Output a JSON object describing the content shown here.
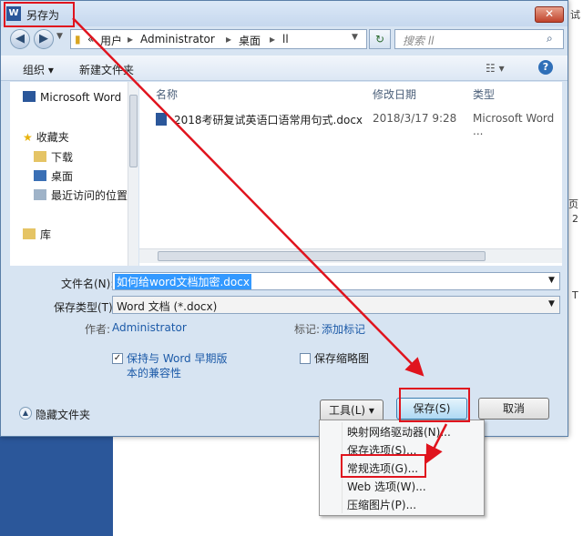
{
  "dialog": {
    "title": "另存为",
    "close": "✕"
  },
  "address": {
    "prefix": "«",
    "crumbs": [
      "用户",
      "Administrator",
      "桌面",
      "ll"
    ],
    "search_placeholder": "搜索 ll"
  },
  "toolbar": {
    "organize": "组织 ▾",
    "new_folder": "新建文件夹"
  },
  "nav": {
    "items": [
      "Microsoft Word",
      "收藏夹",
      "下载",
      "桌面",
      "最近访问的位置",
      "库"
    ]
  },
  "columns": {
    "name": "名称",
    "modified": "修改日期",
    "type": "类型"
  },
  "files": [
    {
      "name": "2018考研复试英语口语常用句式.docx",
      "modified": "2018/3/17 9:28",
      "type": "Microsoft Word ..."
    }
  ],
  "form": {
    "filename_label": "文件名(N):",
    "filename_value": "如何给word文档加密.docx",
    "savetype_label": "保存类型(T):",
    "savetype_value": "Word 文档 (*.docx)",
    "author_label": "作者:",
    "author_value": "Administrator",
    "tags_label": "标记:",
    "tags_value": "添加标记",
    "compat_line1": "保持与 Word 早期版",
    "compat_line2": "本的兼容性",
    "thumbnail": "保存缩略图"
  },
  "footer": {
    "hide_folders": "隐藏文件夹",
    "tools": "工具(L)",
    "save": "保存(S)",
    "cancel": "取消"
  },
  "tools_menu": [
    "映射网络驱动器(N)...",
    "保存选项(S)...",
    "常规选项(G)...",
    "Web 选项(W)...",
    "压缩图片(P)..."
  ],
  "background": {
    "right_text_1": "试",
    "right_text_2": "页",
    "right_text_3": "2",
    "right_text_4": "T"
  },
  "colors": {
    "annotation": "#e0141e",
    "word_blue": "#2b579a"
  }
}
